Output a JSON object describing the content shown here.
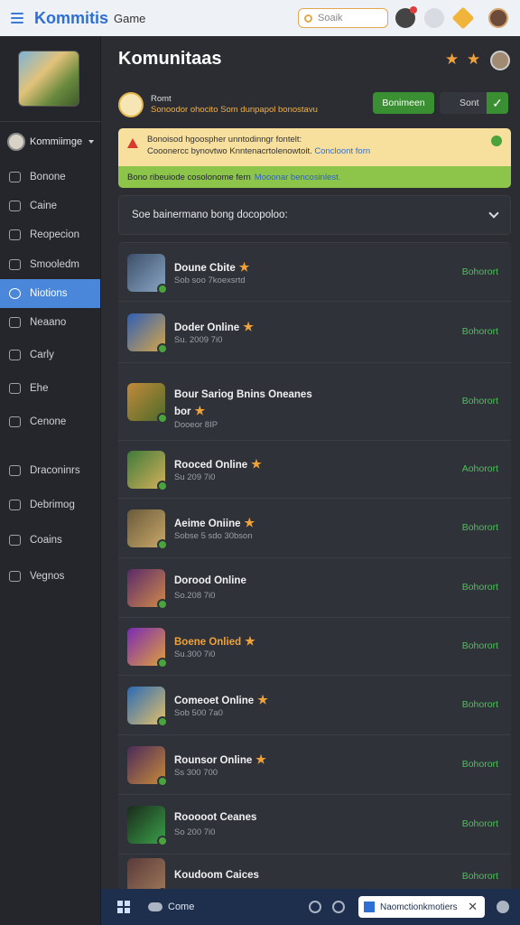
{
  "topbar": {
    "brand": "Kommitis",
    "brand_sub": "Game",
    "search_placeholder": "Soaik"
  },
  "sidebar": {
    "user": "Kommiimge",
    "items": [
      {
        "label": "Bonone",
        "icon": "home-icon"
      },
      {
        "label": "Caine",
        "icon": "card-icon"
      },
      {
        "label": "Reopecion",
        "icon": "chart-icon"
      },
      {
        "label": "Smooledm",
        "icon": "people-icon"
      },
      {
        "label": "Niotions",
        "icon": "globe-icon",
        "active": true
      },
      {
        "label": "Neaano",
        "icon": "image-icon"
      },
      {
        "label": "Carly",
        "icon": "compass-icon"
      },
      {
        "label": "Ehe",
        "icon": "world-icon"
      },
      {
        "label": "Cenone",
        "icon": "tag-icon"
      },
      {
        "label": "Draconinrs",
        "icon": "wrench-icon"
      },
      {
        "label": "Debrimog",
        "icon": "edit-icon"
      },
      {
        "label": "Coains",
        "icon": "link-icon"
      },
      {
        "label": "Vegnos",
        "icon": "eye-icon"
      }
    ]
  },
  "main": {
    "title": "Komunitaas",
    "notice": {
      "line1": "Romt",
      "line2": "Sonoodor ohocito Som dunpapol bonostavu",
      "btn_primary": "Bonimeen",
      "btn_secondary": "Sont"
    },
    "alert": {
      "line1": "Bonoisod hgoospher unntodinngr fontelt:",
      "line2_prefix": "Cooonercc bynovtwo Knntenacrtolenowtoit.",
      "line2_link": "Concloont forn",
      "bottom_text": "Bono ribeuiode cosolonome fern",
      "bottom_link": "Mooonar bencosinlest."
    },
    "dropdown": "Soe bainermano bong docopoloo:",
    "games": [
      {
        "name": "Doune Cbite",
        "sub": "Sob soo 7koexsrtd",
        "status": "Bohorort",
        "star": true
      },
      {
        "name": "Doder Online",
        "sub": "Su. 2009 7i0",
        "status": "Bohorort",
        "star": true
      },
      {
        "name": "Bour Sariog Bnins Oneanes",
        "name2": "bor",
        "sub": "Dooeor 8IP",
        "status": "Bohorort",
        "star": true
      },
      {
        "name": "Rooced Online",
        "sub": "Su 209 7i0",
        "status": "Aohorort",
        "star": true
      },
      {
        "name": "Aeime Oniine",
        "sub": "Sobse 5 sdo 30bson",
        "status": "Bohorort",
        "star": true
      },
      {
        "name": "Dorood Online",
        "sub": "So.208 7i0",
        "status": "Bohorort",
        "star": false
      },
      {
        "name": "Boene Onlied",
        "sub": "Su.300 7i0",
        "status": "Bohorort",
        "star": true,
        "orange": true
      },
      {
        "name": "Comeoet Online",
        "sub": "Sob 500 7a0",
        "status": "Bohorort",
        "star": true
      },
      {
        "name": "Rounsor Online",
        "sub": "Ss 300 700",
        "status": "Bohorort",
        "star": true
      },
      {
        "name": "Rooooot Ceanes",
        "sub": "So 200 7i0",
        "status": "Bohorort",
        "star": false
      },
      {
        "name": "Koudoom Caices",
        "sub": "",
        "status": "Bohorort",
        "star": false
      }
    ]
  },
  "bottombar": {
    "label": "Come",
    "chip": "Naomctionkmotiers"
  },
  "colors": {
    "accent": "#4a86d9",
    "online": "#4cc15a",
    "star": "#f0a23a"
  }
}
